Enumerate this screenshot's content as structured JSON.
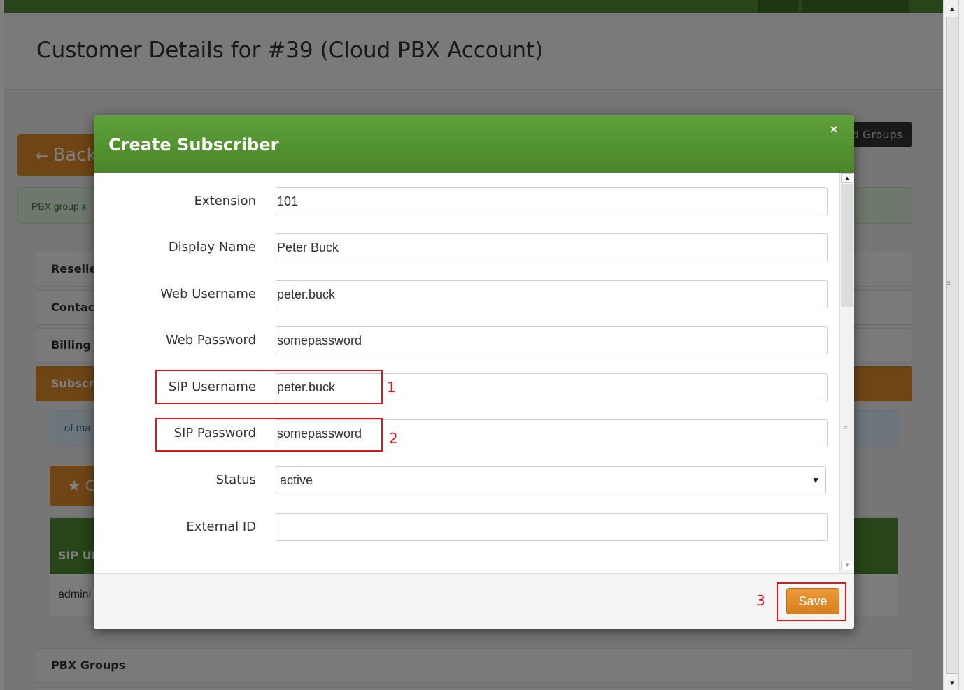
{
  "page": {
    "title": "Customer Details for #39 (Cloud PBX Account)",
    "back_label": "Back",
    "groups_button_label": "d Groups",
    "alert_text": "PBX group s",
    "accordion": [
      "Reseller",
      "Contact",
      "Billing I",
      "Subscri"
    ],
    "info_text": "of ma",
    "star_button_label": "C",
    "table_header": "SIP UR",
    "table_cell": "admini",
    "bottom_section": "PBX Groups"
  },
  "modal": {
    "title": "Create Subscriber",
    "close_label": "×",
    "fields": [
      {
        "label": "Extension",
        "value": "101"
      },
      {
        "label": "Display Name",
        "value": "Peter Buck"
      },
      {
        "label": "Web Username",
        "value": "peter.buck"
      },
      {
        "label": "Web Password",
        "value": "somepassword"
      },
      {
        "label": "SIP Username",
        "value": "peter.buck"
      },
      {
        "label": "SIP Password",
        "value": "somepassword"
      },
      {
        "label": "Status",
        "value": "active",
        "type": "select"
      },
      {
        "label": "External ID",
        "value": ""
      }
    ],
    "save_label": "Save"
  },
  "annotations": {
    "marker_1": "1",
    "marker_2": "2",
    "marker_3": "3",
    "color": "#e3141b"
  },
  "icons": {
    "back": "arrow-left-icon",
    "star": "star-icon",
    "close": "close-icon",
    "caret": "caret-down-icon"
  },
  "colors": {
    "header_green": "#4f8a30",
    "accent_orange": "#e08a2b"
  }
}
